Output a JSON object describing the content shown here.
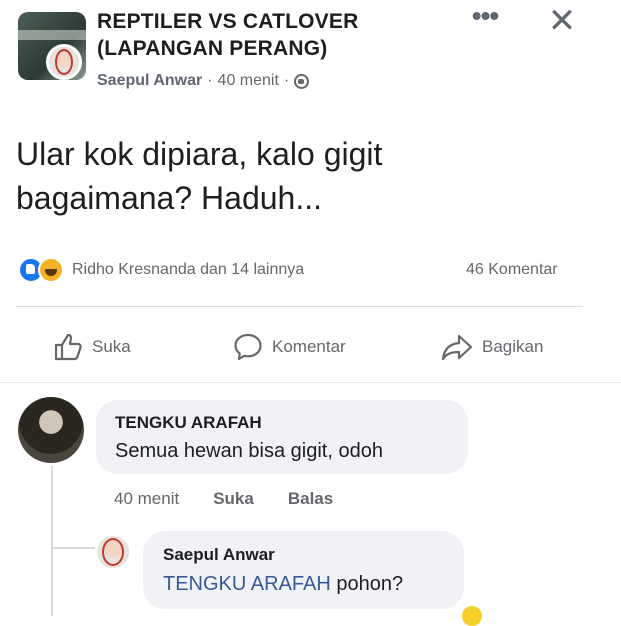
{
  "header": {
    "group_title": "REPTILER VS CATLOVER (LAPANGAN PERANG)",
    "author": "Saepul Anwar",
    "time": "40 menit",
    "separator": "·"
  },
  "post": {
    "text": "Ular kok dipiara, kalo gigit bagaimana? Haduh..."
  },
  "reactions": {
    "summary": "Ridho Kresnanda dan 14 lainnya",
    "comment_count": "46 Komentar"
  },
  "actions": {
    "like": "Suka",
    "comment": "Komentar",
    "share": "Bagikan"
  },
  "comments": [
    {
      "name": "TENGKU ARAFAH",
      "text": "Semua hewan bisa gigit,   odoh",
      "time": "40 menit",
      "like": "Suka",
      "reply": "Balas"
    }
  ],
  "reply": {
    "name": "Saepul Anwar",
    "mention": "TENGKU ARAFAH",
    "text": " pohon?"
  }
}
